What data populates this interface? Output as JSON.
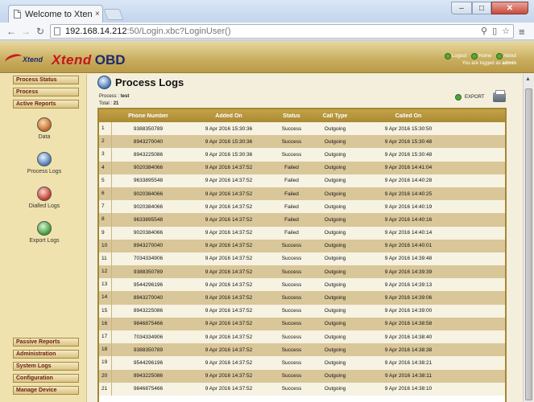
{
  "browser": {
    "tab_title": "Welcome to Xtend C",
    "tab_close": "×",
    "url_host": "192.168.14.212",
    "url_path": ":50/Login.xbc?LoginUser()",
    "window_min": "–",
    "window_max": "□",
    "window_close": "✕",
    "back": "←",
    "forward": "→",
    "reload": "↻",
    "menu": "≡"
  },
  "header": {
    "logo_small": "Xtend",
    "logo_brand": "Xtend",
    "logo_obd": "OBD",
    "links": [
      "Logout",
      "Home",
      "About"
    ],
    "logged_as_prefix": "You are logged as ",
    "logged_as_user": "admin"
  },
  "sidebar": {
    "top_buttons": [
      "Process Status",
      "Process",
      "Active Reports"
    ],
    "icon_items": [
      {
        "label": "Data",
        "icon": "data-icon",
        "color": "#c06a2a"
      },
      {
        "label": "Process Logs",
        "icon": "process-logs-icon",
        "color": "#4a78b0"
      },
      {
        "label": "Dialled Logs",
        "icon": "dialled-logs-icon",
        "color": "#c0392b"
      },
      {
        "label": "Export Logs",
        "icon": "export-logs-icon",
        "color": "#3a9a3a"
      }
    ],
    "bottom_buttons": [
      "Passive Reports",
      "Administration",
      "System Logs",
      "Configuration",
      "Manage Device"
    ]
  },
  "main": {
    "title": "Process Logs",
    "process_label": "Process : ",
    "process_value": "test",
    "total_label": "Total : ",
    "total_value": "21",
    "export_label": "EXPORT",
    "columns": [
      "Phone Number",
      "Added On",
      "Status",
      "Call Type",
      "Called On"
    ],
    "rows": [
      [
        "1",
        "9388350789",
        "9 Apr 2016 15:30:36",
        "Success",
        "Outgoing",
        "9 Apr 2016 15:30:50"
      ],
      [
        "2",
        "8943270040",
        "9 Apr 2016 15:30:36",
        "Success",
        "Outgoing",
        "9 Apr 2016 15:30:48"
      ],
      [
        "3",
        "8943225086",
        "9 Apr 2016 15:30:36",
        "Success",
        "Outgoing",
        "9 Apr 2016 15:30:48"
      ],
      [
        "4",
        "9020384066",
        "9 Apr 2016 14:37:52",
        "Failed",
        "Outgoing",
        "9 Apr 2016 14:41:04"
      ],
      [
        "5",
        "9633895548",
        "9 Apr 2016 14:37:52",
        "Failed",
        "Outgoing",
        "9 Apr 2016 14:40:28"
      ],
      [
        "6",
        "9020384066",
        "9 Apr 2016 14:37:52",
        "Failed",
        "Outgoing",
        "9 Apr 2016 14:40:25"
      ],
      [
        "7",
        "9020384066",
        "9 Apr 2016 14:37:52",
        "Failed",
        "Outgoing",
        "9 Apr 2016 14:40:19"
      ],
      [
        "8",
        "9633895548",
        "9 Apr 2016 14:37:52",
        "Failed",
        "Outgoing",
        "9 Apr 2016 14:40:16"
      ],
      [
        "9",
        "9020384066",
        "9 Apr 2016 14:37:52",
        "Failed",
        "Outgoing",
        "9 Apr 2016 14:40:14"
      ],
      [
        "10",
        "8943270040",
        "9 Apr 2016 14:37:52",
        "Success",
        "Outgoing",
        "9 Apr 2016 14:40:01"
      ],
      [
        "11",
        "7034334906",
        "9 Apr 2016 14:37:52",
        "Success",
        "Outgoing",
        "9 Apr 2016 14:39:48"
      ],
      [
        "12",
        "9388350789",
        "9 Apr 2016 14:37:52",
        "Success",
        "Outgoing",
        "9 Apr 2016 14:39:39"
      ],
      [
        "13",
        "9544296196",
        "9 Apr 2016 14:37:52",
        "Success",
        "Outgoing",
        "9 Apr 2016 14:39:13"
      ],
      [
        "14",
        "8943270040",
        "9 Apr 2016 14:37:52",
        "Success",
        "Outgoing",
        "9 Apr 2016 14:39:06"
      ],
      [
        "15",
        "8943225086",
        "9 Apr 2016 14:37:52",
        "Success",
        "Outgoing",
        "9 Apr 2016 14:39:00"
      ],
      [
        "16",
        "9846875466",
        "9 Apr 2016 14:37:52",
        "Success",
        "Outgoing",
        "9 Apr 2016 14:38:58"
      ],
      [
        "17",
        "7034334906",
        "9 Apr 2016 14:37:52",
        "Success",
        "Outgoing",
        "9 Apr 2016 14:38:40"
      ],
      [
        "18",
        "9388350789",
        "9 Apr 2016 14:37:52",
        "Success",
        "Outgoing",
        "9 Apr 2016 14:38:38"
      ],
      [
        "19",
        "9544296196",
        "9 Apr 2016 14:37:52",
        "Success",
        "Outgoing",
        "9 Apr 2016 14:38:21"
      ],
      [
        "20",
        "8943225086",
        "9 Apr 2016 14:37:52",
        "Success",
        "Outgoing",
        "9 Apr 2016 14:38:11"
      ],
      [
        "21",
        "9846875466",
        "9 Apr 2016 14:37:52",
        "Success",
        "Outgoing",
        "9 Apr 2016 14:38:10"
      ]
    ]
  },
  "colors": {
    "header_gold": "#c8ad5d",
    "table_header": "#a98a34",
    "row_light": "#f7f3e2",
    "row_dark": "#d9c79a",
    "nav_text": "#6b1d10"
  }
}
